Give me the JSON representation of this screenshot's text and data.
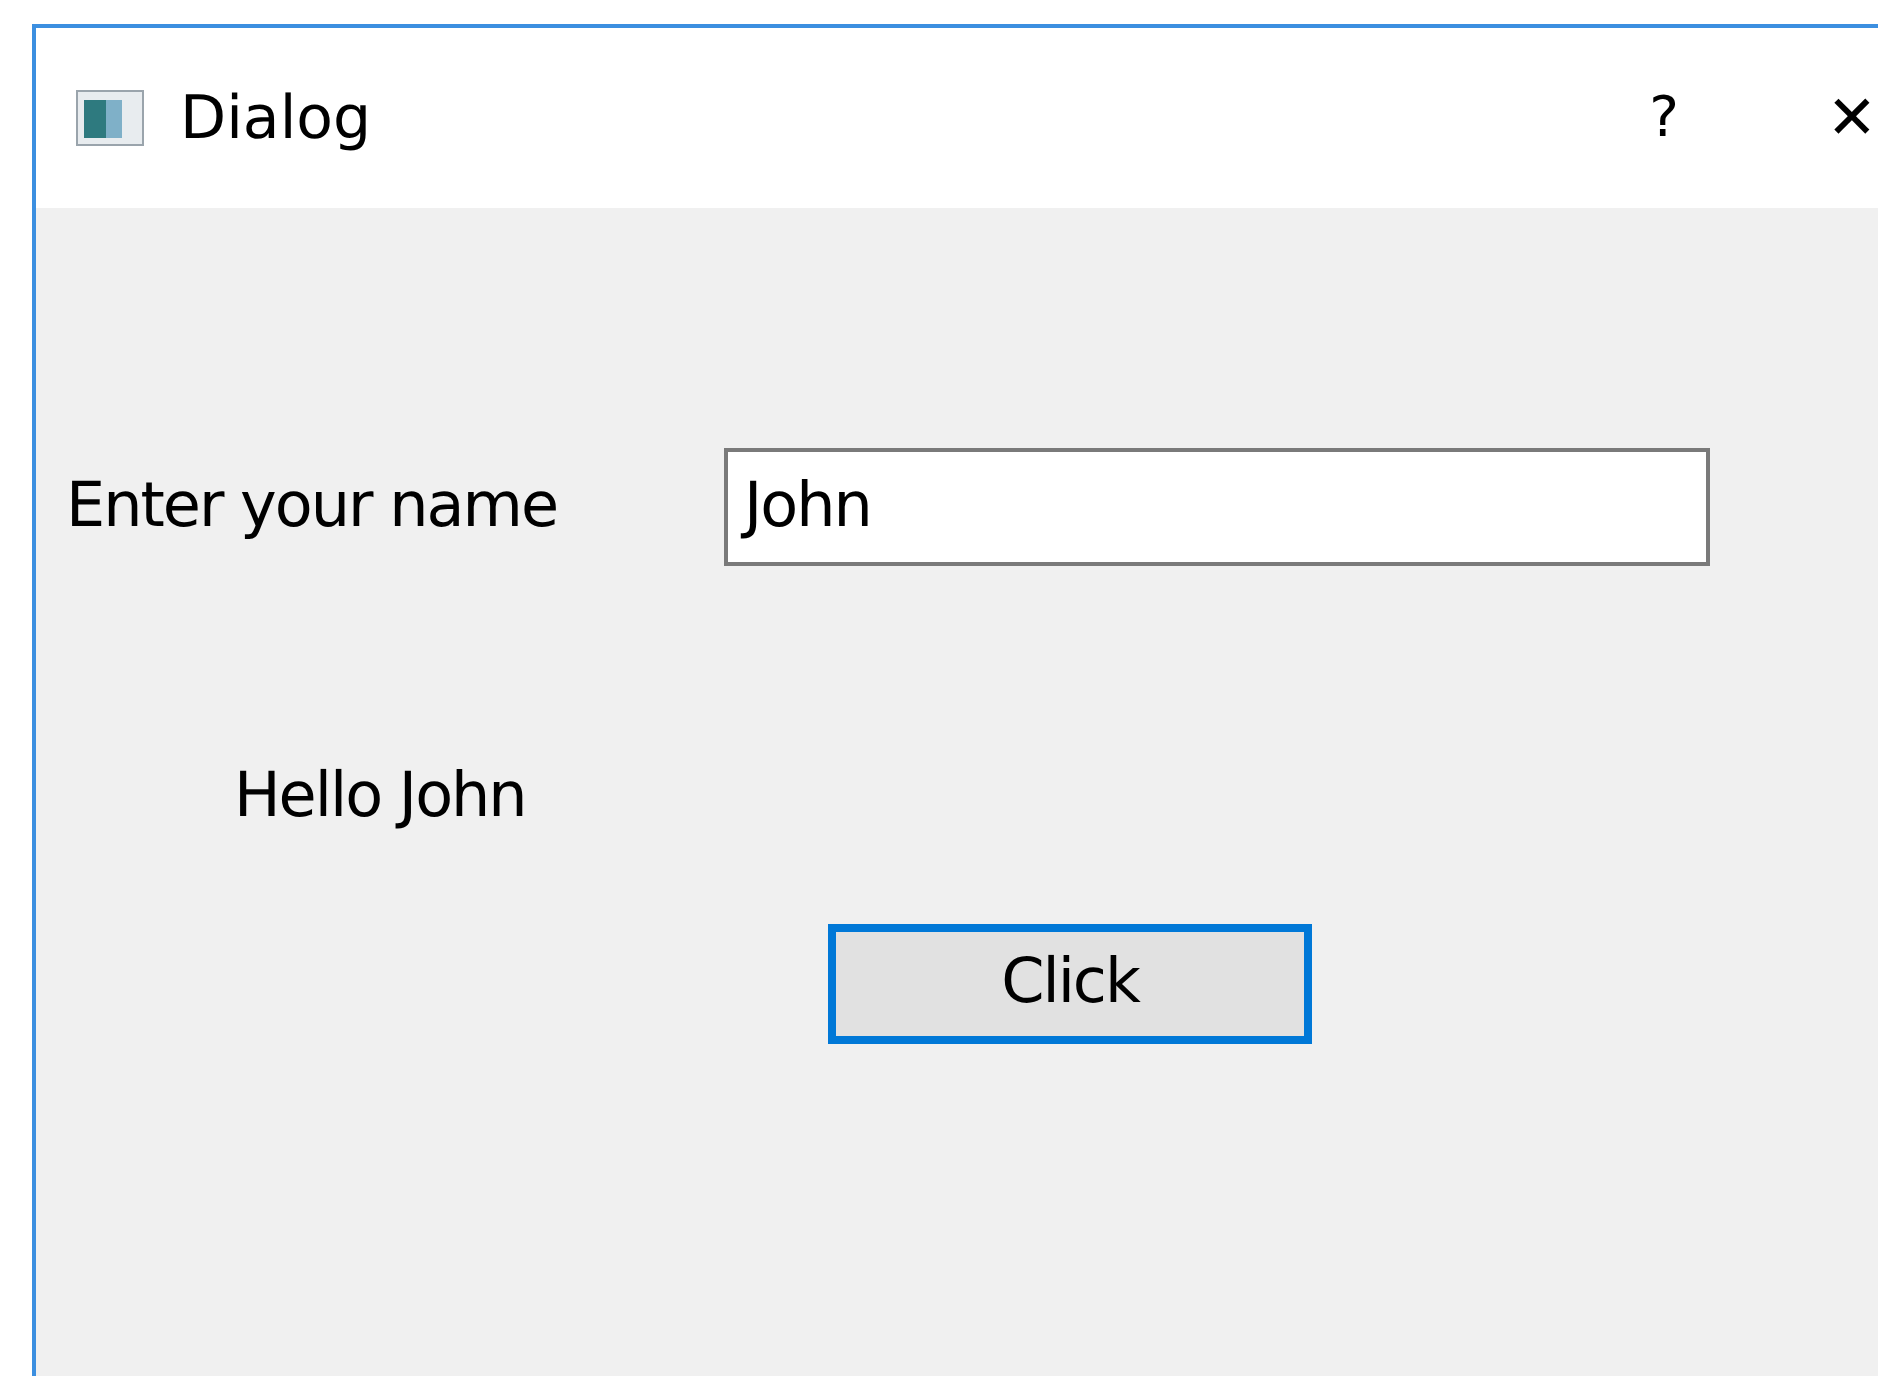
{
  "window": {
    "title": "Dialog",
    "help": "?",
    "close": "✕"
  },
  "form": {
    "label": "Enter your name",
    "value": "John"
  },
  "greeting": "Hello John",
  "button": {
    "label": "Click",
    "focused": true
  }
}
